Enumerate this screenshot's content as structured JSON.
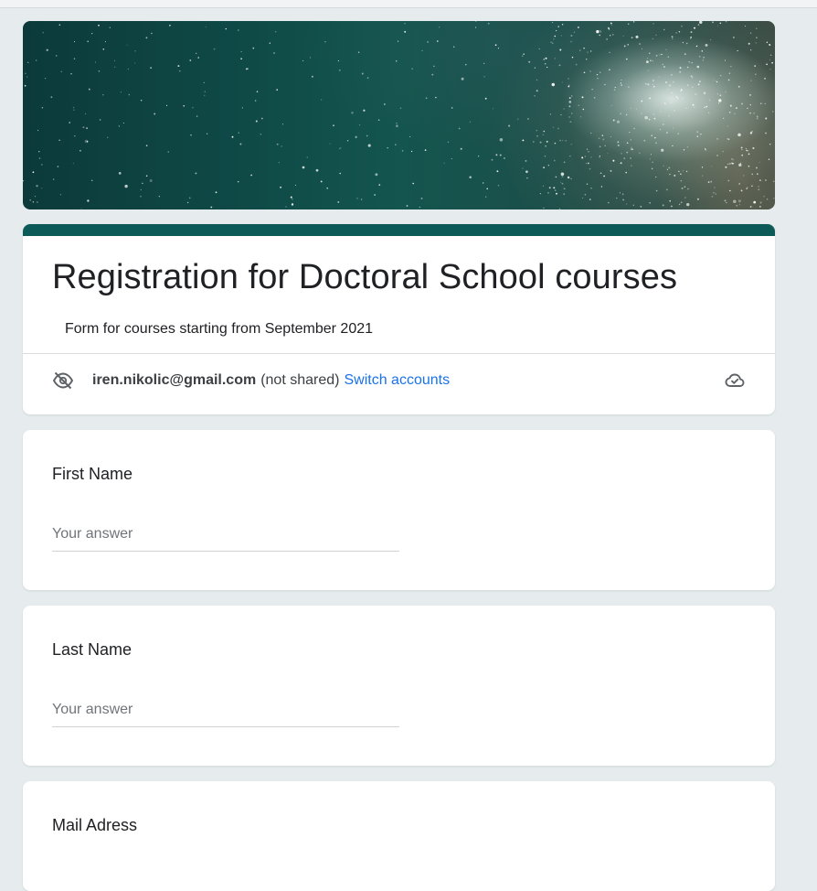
{
  "form": {
    "title": "Registration for Doctoral School courses",
    "description": "Form  for courses starting from September 2021",
    "accent_color": "#0c5a57",
    "account": {
      "email": "iren.nikolic@gmail.com",
      "sharing_status": "(not shared)",
      "switch_label": "Switch accounts",
      "privacy_icon": "eye-off-icon",
      "save_status_icon": "cloud-check-icon"
    }
  },
  "questions": [
    {
      "label": "First Name",
      "placeholder": "Your answer",
      "value": ""
    },
    {
      "label": "Last Name",
      "placeholder": "Your answer",
      "value": ""
    },
    {
      "label": "Mail Adress"
    }
  ]
}
